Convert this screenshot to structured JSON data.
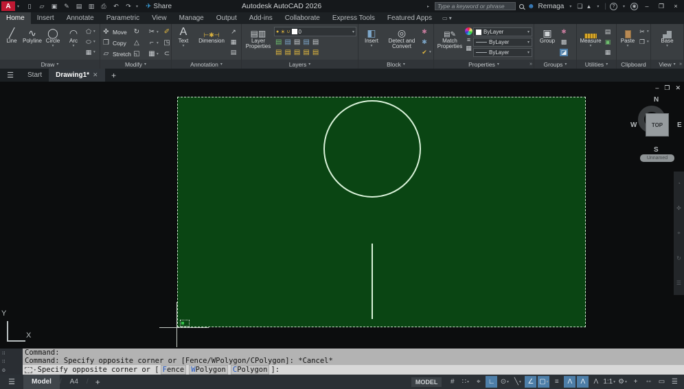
{
  "app": {
    "logo": "A",
    "title": "Autodesk AutoCAD 2026"
  },
  "qat": {
    "share_label": "Share",
    "icons": [
      {
        "name": "new-file-icon",
        "glyph": "▯"
      },
      {
        "name": "open-folder-icon",
        "glyph": "▱"
      },
      {
        "name": "save-icon",
        "glyph": "▣"
      },
      {
        "name": "save-as-icon",
        "glyph": "✎"
      },
      {
        "name": "plot-icon",
        "glyph": "▤"
      },
      {
        "name": "publish-icon",
        "glyph": "▥"
      },
      {
        "name": "print-icon",
        "glyph": "⎙"
      },
      {
        "name": "undo-icon",
        "glyph": "↶"
      },
      {
        "name": "redo-icon",
        "glyph": "↷"
      }
    ]
  },
  "account": {
    "search_placeholder": "Type a keyword or phrase",
    "user": "Remaga"
  },
  "ribbon_tabs": [
    {
      "label": "Home",
      "active": true
    },
    {
      "label": "Insert"
    },
    {
      "label": "Annotate"
    },
    {
      "label": "Parametric"
    },
    {
      "label": "View"
    },
    {
      "label": "Manage"
    },
    {
      "label": "Output"
    },
    {
      "label": "Add-ins"
    },
    {
      "label": "Collaborate"
    },
    {
      "label": "Express Tools"
    },
    {
      "label": "Featured Apps"
    }
  ],
  "panels": {
    "draw": {
      "label": "Draw",
      "tools": [
        {
          "name": "line-tool",
          "label": "Line",
          "glyph": "╱"
        },
        {
          "name": "polyline-tool",
          "label": "Polyline",
          "glyph": "∿"
        },
        {
          "name": "circle-tool",
          "label": "Circle",
          "glyph": "◯",
          "caret": true
        },
        {
          "name": "arc-tool",
          "label": "Arc",
          "glyph": "◠",
          "caret": true
        }
      ],
      "small": [
        {
          "name": "polygon-tool-icon",
          "glyph": "⬠",
          "caret": true
        },
        {
          "name": "ellipse-tool-icon",
          "glyph": "⬭",
          "caret": true
        },
        {
          "name": "hatch-tool-icon",
          "glyph": "▦",
          "caret": true
        }
      ]
    },
    "modify": {
      "label": "Modify",
      "tools": [
        {
          "name": "move-tool",
          "label": "Move",
          "glyph": "✜"
        },
        {
          "name": "copy-tool",
          "label": "Copy",
          "glyph": "❐"
        },
        {
          "name": "stretch-tool",
          "label": "Stretch",
          "glyph": "▱"
        }
      ],
      "rows": [
        [
          {
            "name": "rotate-icon",
            "glyph": "↻"
          },
          {
            "name": "trim-icon",
            "glyph": "✂",
            "caret": true
          },
          {
            "name": "erase-icon",
            "glyph": "✐",
            "tint": "yellow"
          }
        ],
        [
          {
            "name": "mirror-icon",
            "glyph": "△"
          },
          {
            "name": "fillet-icon",
            "glyph": "⌐",
            "caret": true
          },
          {
            "name": "explode-icon",
            "glyph": "◳"
          }
        ],
        [
          {
            "name": "scale-icon",
            "glyph": "◱"
          },
          {
            "name": "array-icon",
            "glyph": "▦",
            "caret": true
          },
          {
            "name": "offset-icon",
            "glyph": "⊂"
          }
        ]
      ]
    },
    "annotation": {
      "label": "Annotation",
      "text_label": "Text",
      "dimension_label": "Dimension",
      "text_glyph": "A",
      "dimension_glyph": "⊢✱⊣",
      "small": [
        {
          "name": "leader-icon",
          "glyph": "↗"
        },
        {
          "name": "table-icon",
          "glyph": "▦"
        },
        {
          "name": "markup-icon",
          "glyph": "▤"
        }
      ]
    },
    "layers": {
      "label": "Layers",
      "properties_label": "Layer Properties",
      "bulb_glyph": "●",
      "sun_glyph": "☀",
      "lock_glyph": "∪",
      "current_layer": "0",
      "rows": [
        [
          {
            "name": "layer-off-icon",
            "glyph": "▤",
            "tint": "green"
          },
          {
            "name": "layer-isolate-icon",
            "glyph": "▤",
            "tint": "blue"
          },
          {
            "name": "layer-freeze-icon",
            "glyph": "▤"
          },
          {
            "name": "layer-lock-icon",
            "glyph": "▤",
            "tint": "blue"
          },
          {
            "name": "layer-state-icon",
            "glyph": "▤"
          }
        ],
        [
          {
            "name": "layer-unisolate-icon",
            "glyph": "▤",
            "tint": "yellow"
          },
          {
            "name": "layer-thaw-icon",
            "glyph": "▤",
            "tint": "yellow"
          },
          {
            "name": "layer-unlock-icon",
            "glyph": "▤",
            "tint": "yellow"
          },
          {
            "name": "layer-walk-icon",
            "glyph": "▤",
            "tint": "yellow"
          },
          {
            "name": "layer-match-icon",
            "glyph": "▤",
            "tint": "yellow"
          }
        ]
      ]
    },
    "block": {
      "label": "Block",
      "insert_label": "Insert",
      "insert_glyph": "◧",
      "detect_label": "Detect and Convert",
      "detect_glyph": "◎",
      "small": [
        {
          "name": "block-edit-icon",
          "glyph": "✱",
          "tint": "pink"
        },
        {
          "name": "block-create-icon",
          "glyph": "✱",
          "tint": "blue"
        },
        {
          "name": "block-attributes-icon",
          "glyph": "✔",
          "tint": "yellow",
          "caret": true
        }
      ]
    },
    "properties": {
      "label": "Properties",
      "match_label": "Match Properties",
      "match_glyph": "▤✎",
      "color_value": "ByLayer",
      "lineweight_value": "ByLayer",
      "linetype_value": "ByLayer",
      "expander": "»"
    },
    "groups": {
      "label": "Groups",
      "group_label": "Group",
      "group_glyph": "▣",
      "small": [
        {
          "name": "ungroup-icon",
          "glyph": "✱",
          "tint": "pink"
        },
        {
          "name": "group-edit-icon",
          "glyph": "▩"
        },
        {
          "name": "group-select-icon",
          "glyph": "◪",
          "on": true
        }
      ]
    },
    "utilities": {
      "label": "Utilities",
      "measure_label": "Measure",
      "small": [
        {
          "name": "id-point-icon",
          "glyph": "▤"
        },
        {
          "name": "quick-select-icon",
          "glyph": "▣",
          "tint": "green"
        },
        {
          "name": "quick-calculator-icon",
          "glyph": "▦"
        }
      ]
    },
    "clipboard": {
      "label": "Clipboard",
      "paste_label": "Paste",
      "small": [
        {
          "name": "cut-icon",
          "glyph": "✂",
          "caret": true
        },
        {
          "name": "copy-clip-icon",
          "glyph": "❐",
          "caret": true
        }
      ]
    },
    "view": {
      "label": "View",
      "base_label": "Base",
      "expander": "»"
    }
  },
  "file_tabs": {
    "start": "Start",
    "drawing": "Drawing1*"
  },
  "canvas": {
    "viewcube": {
      "n": "N",
      "e": "E",
      "s": "S",
      "w": "W",
      "face": "TOP",
      "wcs": "Unnamed"
    },
    "ucs": {
      "x": "X",
      "y": "Y"
    }
  },
  "command": {
    "history": [
      "Command:",
      "Command: Specify opposite corner or [Fence/WPolygon/CPolygon]: *Cancel*"
    ],
    "prompt": "Specify opposite corner or [",
    "options": [
      {
        "label": "Fence"
      },
      {
        "label": "WPolygon"
      },
      {
        "label": "CPolygon"
      }
    ],
    "suffix": "]:"
  },
  "status": {
    "model_tab": "Model",
    "layout_tab": "A4",
    "model_badge": "MODEL",
    "icons": [
      {
        "name": "grid-icon",
        "glyph": "#"
      },
      {
        "name": "snap-mode-icon",
        "glyph": "∷",
        "caret": true
      },
      {
        "name": "dynamic-input-icon",
        "glyph": "⌖"
      },
      {
        "name": "ortho-mode-icon",
        "glyph": "∟",
        "on": true
      },
      {
        "name": "polar-tracking-icon",
        "glyph": "⊙",
        "caret": true
      },
      {
        "name": "isometric-drafting-icon",
        "glyph": "╲",
        "caret": true
      },
      {
        "name": "object-snap-tracking-icon",
        "glyph": "∠",
        "on": true
      },
      {
        "name": "object-snap-icon",
        "glyph": "▢",
        "on": true,
        "caret": true
      },
      {
        "name": "lineweight-icon",
        "glyph": "≡"
      },
      {
        "name": "annotation-visibility-icon",
        "glyph": "Λ",
        "on": true
      },
      {
        "name": "autoscale-icon",
        "glyph": "Λ",
        "on": true
      },
      {
        "name": "annotation-scale-icon",
        "glyph": "Λ"
      },
      {
        "name": "scale-value",
        "glyph": "1:1",
        "caret": true
      },
      {
        "name": "workspace-icon",
        "glyph": "⚙",
        "caret": true
      },
      {
        "name": "annotation-monitor-icon",
        "glyph": "+"
      },
      {
        "name": "isolate-objects-icon",
        "glyph": "◦◦"
      },
      {
        "name": "clean-screen-icon",
        "glyph": "▭"
      },
      {
        "name": "customize-icon",
        "glyph": "☰"
      }
    ]
  }
}
